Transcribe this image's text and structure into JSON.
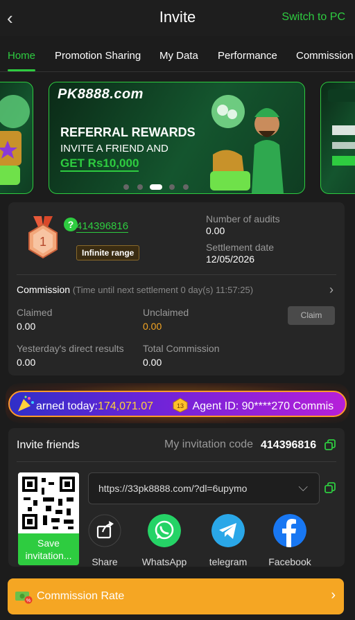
{
  "header": {
    "title": "Invite",
    "switch_label": "Switch to PC"
  },
  "tabs": [
    {
      "label": "Home"
    },
    {
      "label": "Promotion Sharing"
    },
    {
      "label": "My Data"
    },
    {
      "label": "Performance"
    },
    {
      "label": "Commission"
    }
  ],
  "banner": {
    "brand": "PK8888.com",
    "title": "REFERRAL REWARDS",
    "subtitle": "INVITE A FRIEND AND",
    "reward": "GET Rs10,000",
    "slides": 5,
    "active_slide": 3
  },
  "agent": {
    "level": "1",
    "id": "414396816",
    "range_badge": "Infinite range",
    "audits_label": "Number of audits",
    "audits_value": "0.00",
    "settlement_label": "Settlement date",
    "settlement_value": "12/05/2026"
  },
  "commission": {
    "title": "Commission",
    "note": "(Time until next settlement 0 day(s) 11:57:25)",
    "claimed_label": "Claimed",
    "claimed_value": "0.00",
    "unclaimed_label": "Unclaimed",
    "unclaimed_value": "0.00",
    "claim_button": "Claim",
    "yesterday_label": "Yesterday's direct results",
    "yesterday_value": "0.00",
    "total_label": "Total Commission",
    "total_value": "0.00"
  },
  "ticker": {
    "earned_label": "arned today:",
    "earned_value": "174,071.07",
    "agent_level": "13",
    "agent_text": "Agent ID: 90****270 Commis"
  },
  "invite": {
    "title": "Invite friends",
    "code_label": "My invitation code",
    "code_value": "414396816",
    "save_button": "Save invitation...",
    "link": "https://33pk8888.com/?dl=6upymo",
    "share_items": [
      {
        "label": "Share",
        "icon": "share-icon"
      },
      {
        "label": "WhatsApp",
        "icon": "whatsapp-icon"
      },
      {
        "label": "telegram",
        "icon": "telegram-icon"
      },
      {
        "label": "Facebook",
        "icon": "facebook-icon"
      }
    ]
  },
  "rate_bar": {
    "label": "Commission Rate"
  },
  "colors": {
    "accent": "#2ecc40",
    "warning": "#f5a623",
    "background": "#1c1c1c",
    "card": "#262626"
  }
}
